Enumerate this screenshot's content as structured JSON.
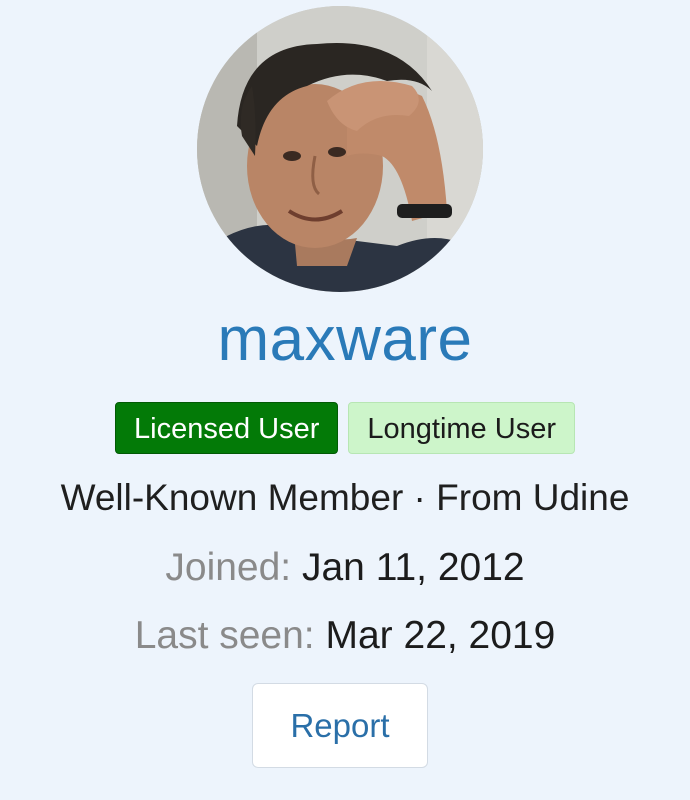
{
  "profile": {
    "avatar_alt": "avatar",
    "username": "maxware",
    "badges": [
      {
        "label": "Licensed User",
        "color": "#037a07",
        "text_color": "#ffffff"
      },
      {
        "label": "Longtime User",
        "color": "#cdf5ca",
        "text_color": "#1b1b1b"
      }
    ],
    "member_line": "Well-Known Member · From Udine",
    "joined": {
      "label": "Joined:",
      "value": "Jan 11, 2012"
    },
    "last_seen": {
      "label": "Last seen:",
      "value": "Mar 22, 2019"
    },
    "report_label": "Report"
  },
  "colors": {
    "background": "#edf4fc",
    "username": "#2a7ab8",
    "link": "#2a6fa8",
    "muted": "#8a8a8a"
  }
}
